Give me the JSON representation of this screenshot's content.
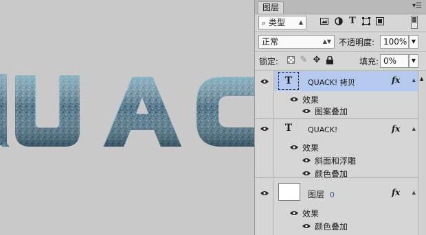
{
  "canvas": {
    "text": "QUAC",
    "fill_color": "#4d6d80",
    "highlight_color": "#9fcbd8",
    "shadow_color": "#2c4656"
  },
  "panel": {
    "tab_label": "图层",
    "menu_icon": "panel-menu-icon",
    "filter": {
      "search_icon": "search-icon",
      "label": "类型"
    },
    "filter_icons": [
      "image-filter-icon",
      "adjustment-filter-icon",
      "type-filter-icon",
      "shape-filter-icon",
      "smart-object-filter-icon"
    ],
    "blend_mode": "正常",
    "opacity_label": "不透明度:",
    "opacity_value": "100%",
    "lock_label": "锁定:",
    "lock_icons": [
      "lock-transparent-icon",
      "lock-pixels-icon",
      "lock-position-icon",
      "lock-all-icon"
    ],
    "fill_label": "填充:",
    "fill_value": "0%"
  },
  "layers": [
    {
      "name": "QUACK! 拷贝",
      "type_glyph": "T",
      "selected": true,
      "fx": "fx",
      "effects_label": "效果",
      "effects": [
        "图案叠加"
      ]
    },
    {
      "name": "QUACK!",
      "type_glyph": "T",
      "selected": false,
      "fx": "fx",
      "effects_label": "效果",
      "effects": [
        "斜面和浮雕",
        "颜色叠加"
      ]
    },
    {
      "name": "图层",
      "name_suffix": "0",
      "type_glyph": "",
      "selected": false,
      "fx": "fx",
      "effects_label": "效果",
      "effects": [
        "颜色叠加"
      ]
    }
  ],
  "colors": {
    "selected_row": "#b5c8ee",
    "layer0_suffix": "#3355aa"
  }
}
